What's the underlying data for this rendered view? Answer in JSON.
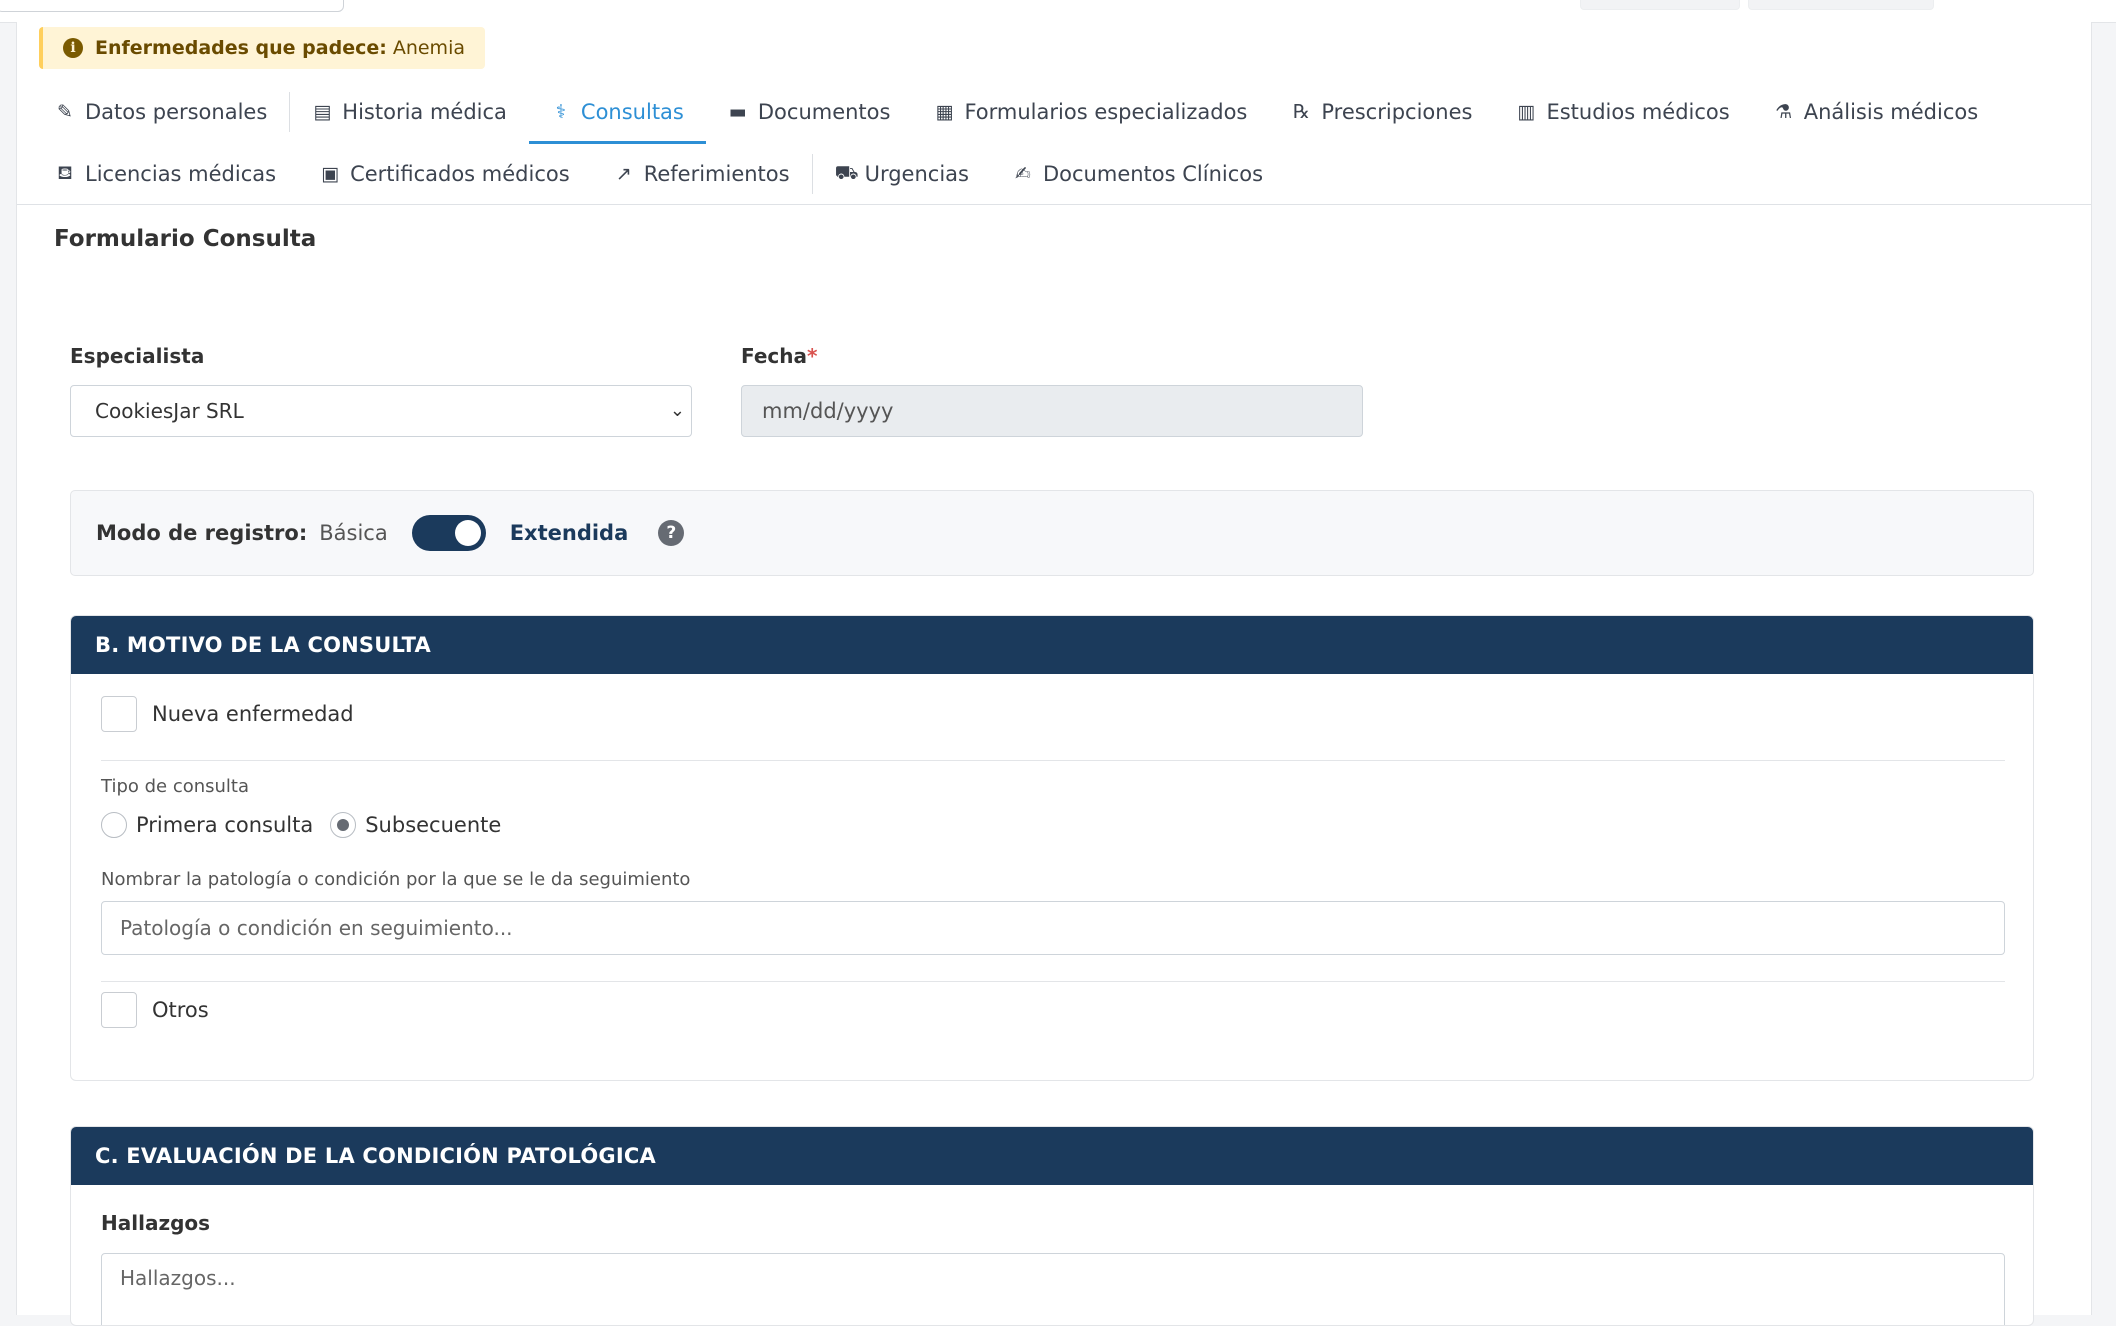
{
  "alert": {
    "label": "Enfermedades que padece:",
    "value": "Anemia",
    "icon": "info-icon"
  },
  "tabs": [
    {
      "label": "Datos personales",
      "icon": "pencil-icon",
      "glyph": "✎"
    },
    {
      "label": "Historia médica",
      "icon": "file-medical-icon",
      "glyph": "▤"
    },
    {
      "label": "Consultas",
      "icon": "stethoscope-icon",
      "glyph": "⚕",
      "active": true
    },
    {
      "label": "Documentos",
      "icon": "folder-icon",
      "glyph": "▬"
    },
    {
      "label": "Formularios especializados",
      "icon": "clipboard-icon",
      "glyph": "▦"
    },
    {
      "label": "Prescripciones",
      "icon": "prescription-icon",
      "glyph": "℞"
    },
    {
      "label": "Estudios médicos",
      "icon": "notes-medical-icon",
      "glyph": "▥"
    },
    {
      "label": "Análisis médicos",
      "icon": "flask-icon",
      "glyph": "⚗"
    },
    {
      "label": "Licencias médicas",
      "icon": "bed-icon",
      "glyph": "⛾"
    },
    {
      "label": "Certificados médicos",
      "icon": "file-certificate-icon",
      "glyph": "▣"
    },
    {
      "label": "Referimientos",
      "icon": "share-icon",
      "glyph": "↗"
    },
    {
      "label": "Urgencias",
      "icon": "ambulance-icon",
      "glyph": "⛟"
    },
    {
      "label": "Documentos Clínicos",
      "icon": "file-signature-icon",
      "glyph": "✍"
    }
  ],
  "form": {
    "title": "Formulario Consulta",
    "especialista_label": "Especialista",
    "especialista_value": "CookiesJar SRL",
    "fecha_label": "Fecha",
    "fecha_required": "*",
    "fecha_placeholder": "mm/dd/yyyy"
  },
  "mode": {
    "label": "Modo de registro:",
    "basic": "Básica",
    "extended": "Extendida",
    "help": "?",
    "extended_on": true
  },
  "section_b": {
    "title": "B. MOTIVO DE LA CONSULTA",
    "nueva_enfermedad": "Nueva enfermedad",
    "tipo_label": "Tipo de consulta",
    "radio_primera": "Primera consulta",
    "radio_subsecuente": "Subsecuente",
    "selected": "Subsecuente",
    "patologia_label": "Nombrar la patología o condición por la que se le da seguimiento",
    "patologia_placeholder": "Patología o condición en seguimiento...",
    "otros": "Otros"
  },
  "section_c": {
    "title": "C. EVALUACIÓN DE LA CONDICIÓN PATOLÓGICA",
    "hallazgos_label": "Hallazgos",
    "hallazgos_placeholder": "Hallazgos..."
  },
  "colors": {
    "accent": "#2d8fd5",
    "header": "#1b3a5c",
    "alert_bg": "#fff4d6"
  }
}
